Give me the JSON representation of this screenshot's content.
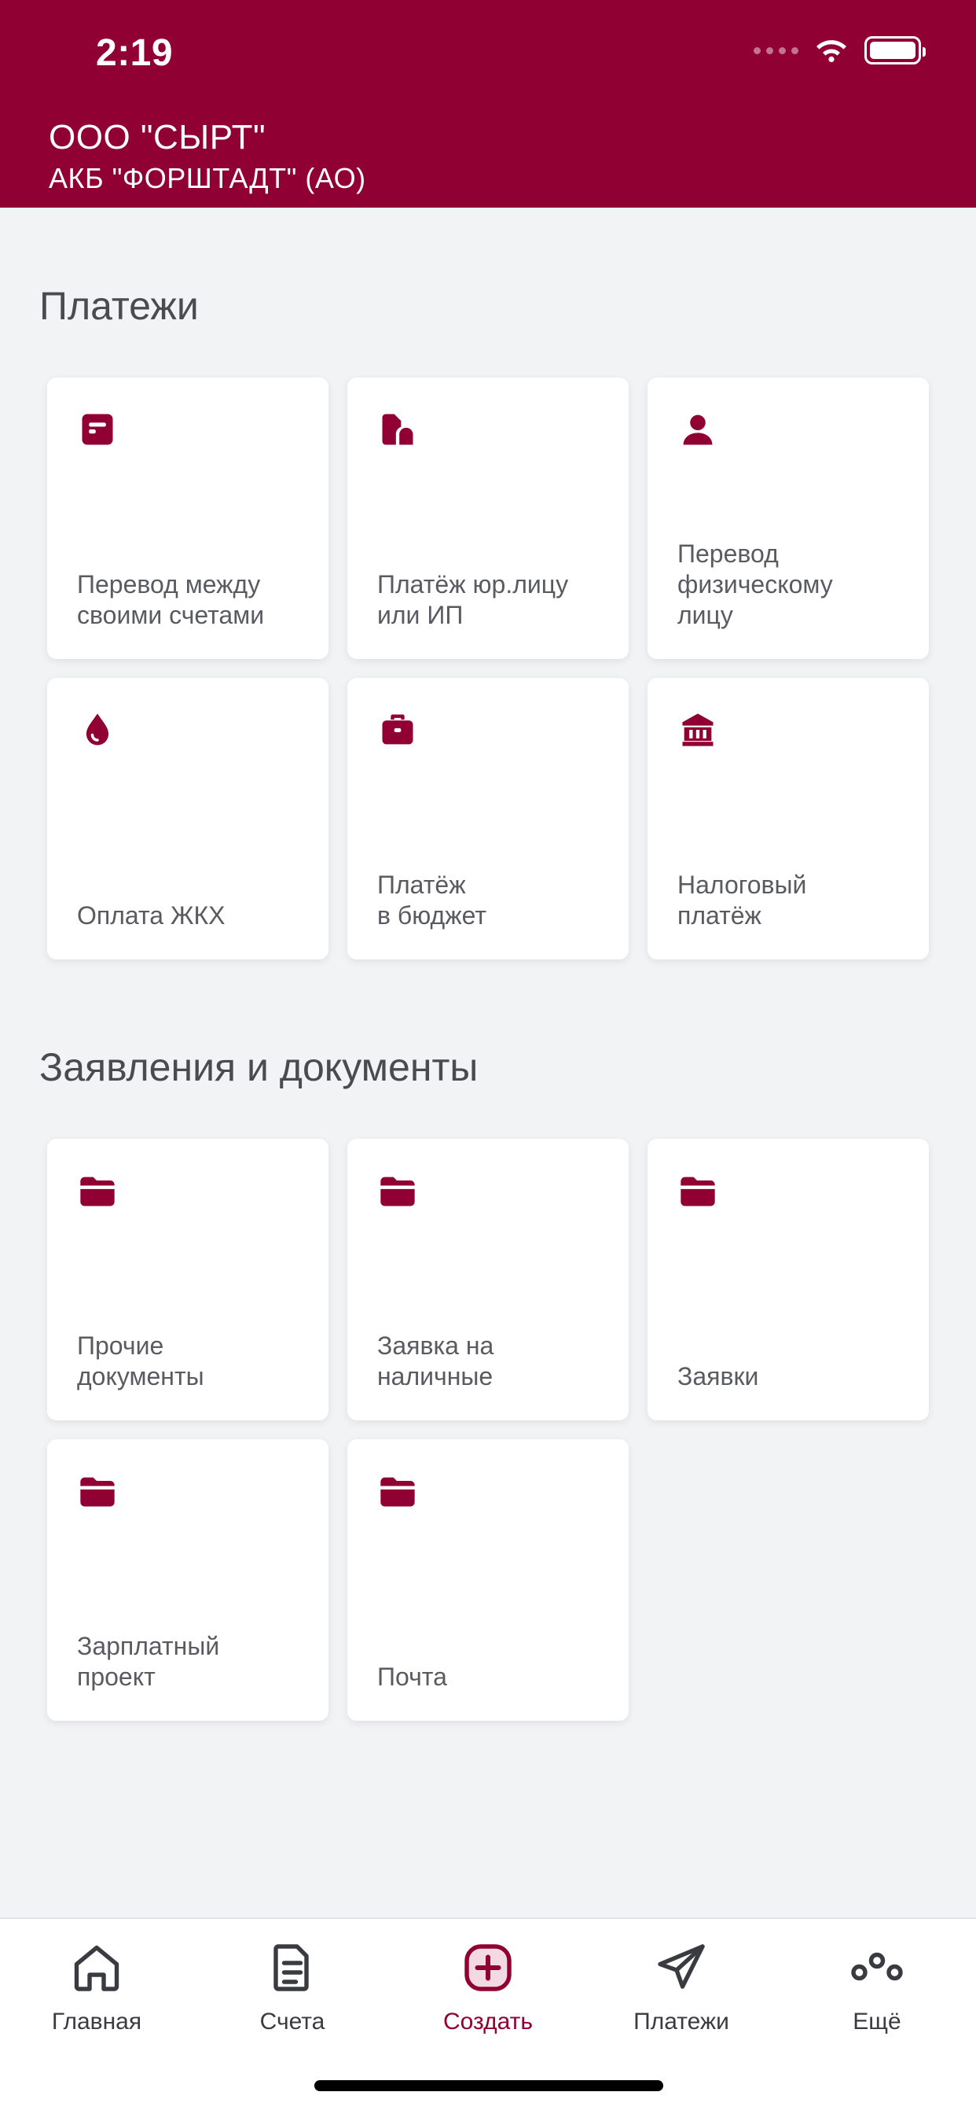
{
  "status_bar": {
    "time": "2:19"
  },
  "header": {
    "company": "ООО \"СЫРТ\"",
    "bank": "АКБ \"ФОРШТАДТ\" (АО)"
  },
  "sections": {
    "payments": {
      "title": "Платежи",
      "items": [
        {
          "label": "Перевод между\nсвоими счетами",
          "icon": "document-icon"
        },
        {
          "label": "Платёж юр.лицу\nили ИП",
          "icon": "company-icon"
        },
        {
          "label": "Перевод\nфизическому\nлицу",
          "icon": "person-icon"
        },
        {
          "label": "Оплата ЖКХ",
          "icon": "drop-icon"
        },
        {
          "label": "Платёж\nв бюджет",
          "icon": "briefcase-icon"
        },
        {
          "label": "Налоговый\nплатёж",
          "icon": "bank-building-icon"
        }
      ]
    },
    "documents": {
      "title": "Заявления и документы",
      "items": [
        {
          "label": "Прочие\nдокументы",
          "icon": "folder-icon"
        },
        {
          "label": "Заявка на\nналичные",
          "icon": "folder-icon"
        },
        {
          "label": "Заявки",
          "icon": "folder-icon"
        },
        {
          "label": "Зарплатный\nпроект",
          "icon": "folder-icon"
        },
        {
          "label": "Почта",
          "icon": "folder-icon"
        }
      ]
    }
  },
  "tabbar": {
    "tabs": [
      {
        "label": "Главная",
        "icon": "home-icon"
      },
      {
        "label": "Счета",
        "icon": "accounts-icon"
      },
      {
        "label": "Создать",
        "icon": "plus-icon",
        "active": true
      },
      {
        "label": "Платежи",
        "icon": "send-icon"
      },
      {
        "label": "Ещё",
        "icon": "more-icon"
      }
    ]
  },
  "colors": {
    "brand": "#900032",
    "background": "#f2f3f5",
    "card": "#ffffff"
  }
}
